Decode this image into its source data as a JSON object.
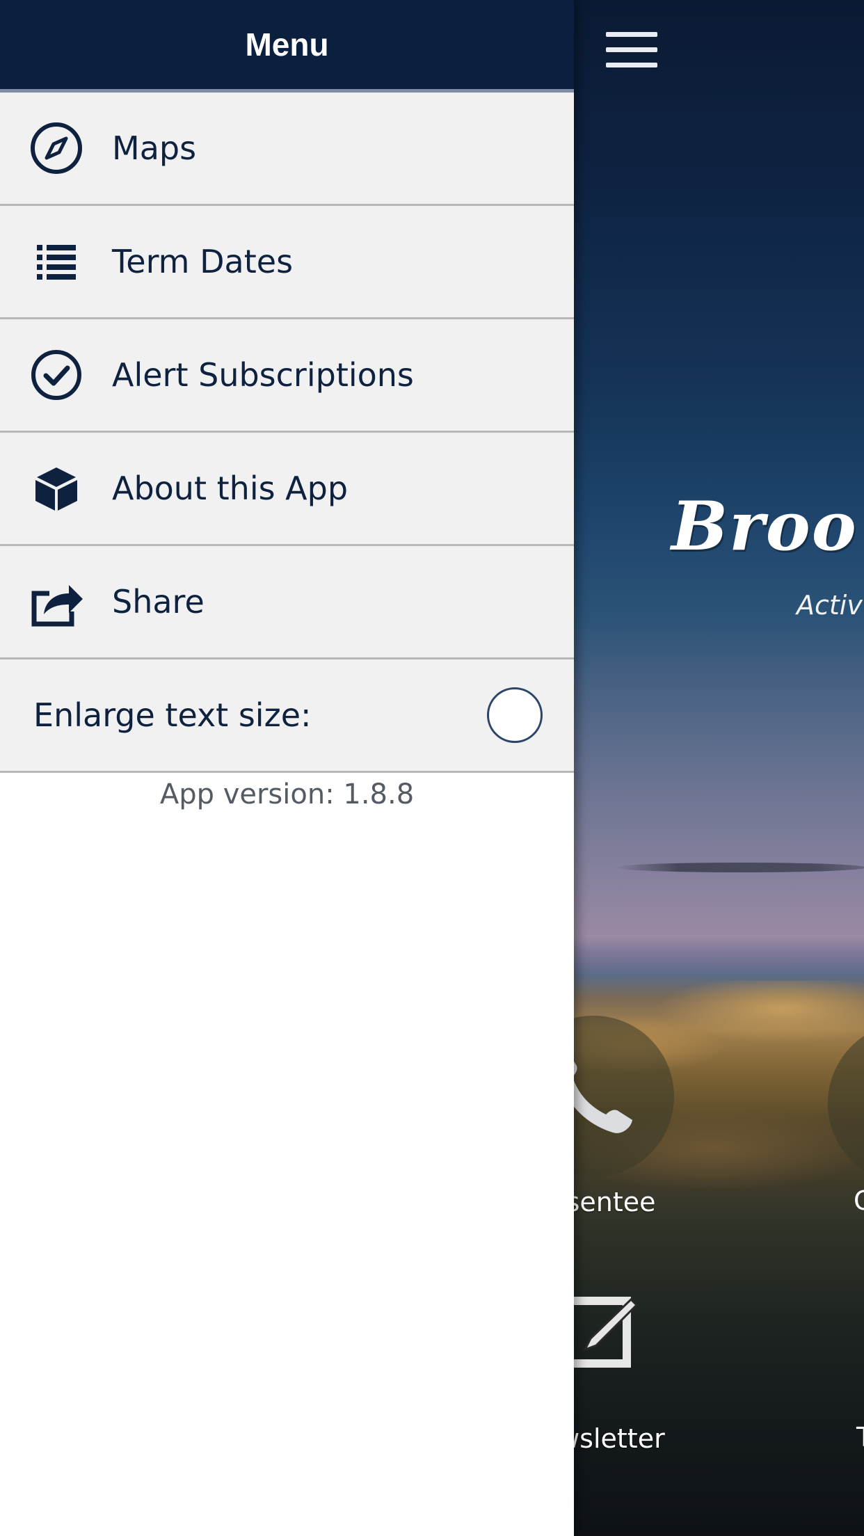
{
  "drawer": {
    "title": "Menu",
    "items": [
      {
        "label": "Maps",
        "icon": "compass-icon"
      },
      {
        "label": "Term Dates",
        "icon": "list-icon"
      },
      {
        "label": "Alert Subscriptions",
        "icon": "check-circle-icon"
      },
      {
        "label": "About this App",
        "icon": "cube-icon"
      },
      {
        "label": "Share",
        "icon": "share-icon"
      }
    ],
    "enlarge_text": {
      "label": "Enlarge text size:",
      "checked": false
    },
    "version": "App version: 1.8.8"
  },
  "home": {
    "menu_icon": "hamburger-menu-icon",
    "logo_text": "Broo",
    "tagline": "Activ",
    "tiles": [
      {
        "label": "Absentee",
        "icon": "phone-icon"
      },
      {
        "label": "Newsletter",
        "icon": "edit-icon"
      }
    ],
    "partial_labels": [
      "C",
      "T"
    ]
  },
  "colors": {
    "header_bg": "#0b1f3e",
    "item_bg": "#f1f1f1",
    "text": "#0e2240",
    "divider": "#b8b8b8"
  }
}
